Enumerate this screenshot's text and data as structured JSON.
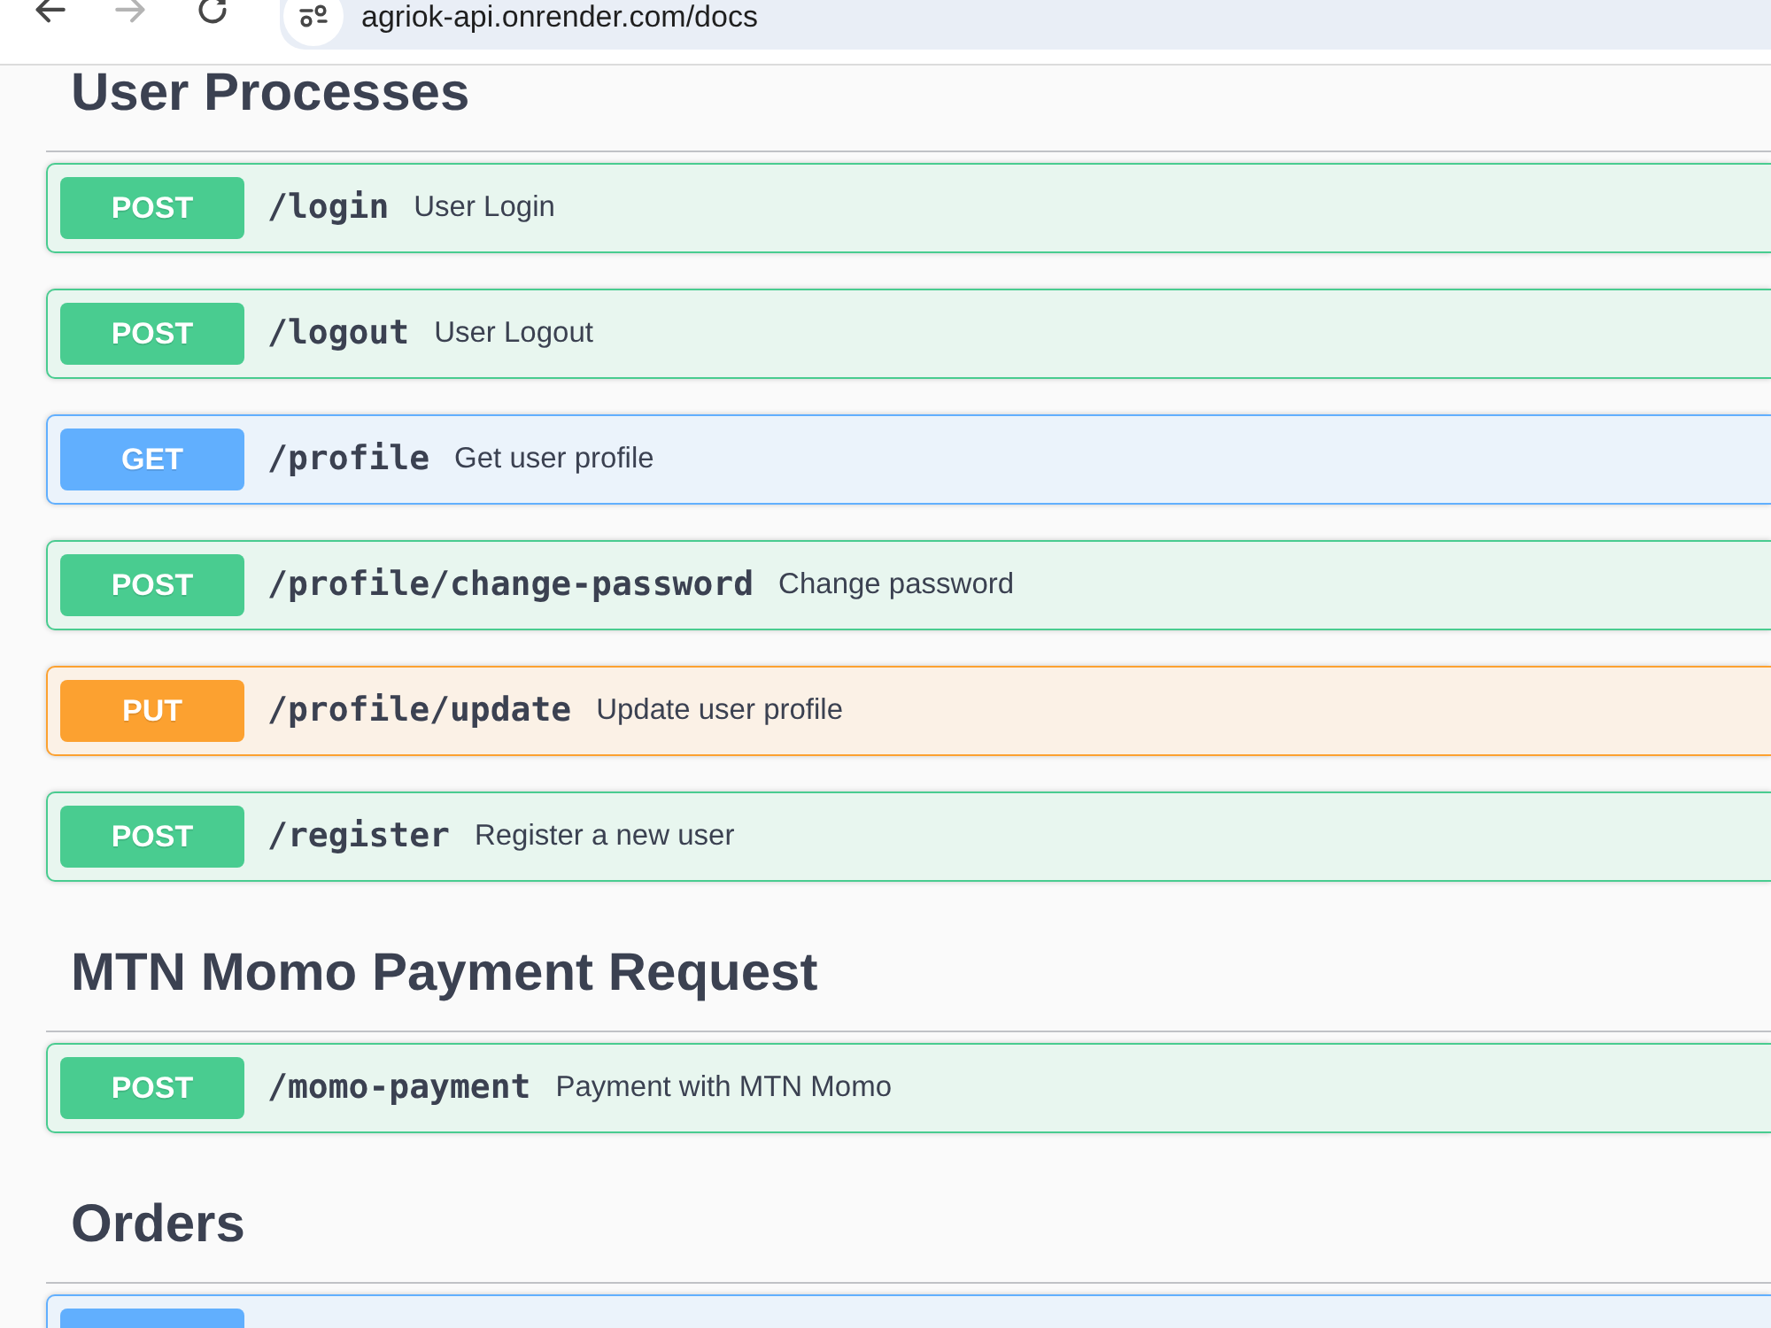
{
  "browser": {
    "nav_buttons": [
      {
        "kind": "back",
        "disabled": false
      },
      {
        "kind": "forward",
        "disabled": true
      },
      {
        "kind": "reload",
        "disabled": false
      }
    ],
    "url": "agriok-api.onrender.com/docs"
  },
  "sections": [
    {
      "title": "User Processes",
      "operations": [
        {
          "kind": "post",
          "method": "POST",
          "path": "/login",
          "summary": "User Login"
        },
        {
          "kind": "post",
          "method": "POST",
          "path": "/logout",
          "summary": "User Logout"
        },
        {
          "kind": "get",
          "method": "GET",
          "path": "/profile",
          "summary": "Get user profile"
        },
        {
          "kind": "post",
          "method": "POST",
          "path": "/profile/change-password",
          "summary": "Change password"
        },
        {
          "kind": "put",
          "method": "PUT",
          "path": "/profile/update",
          "summary": "Update user profile"
        },
        {
          "kind": "post",
          "method": "POST",
          "path": "/register",
          "summary": "Register a new user"
        }
      ]
    },
    {
      "title": "MTN Momo Payment Request",
      "operations": [
        {
          "kind": "post",
          "method": "POST",
          "path": "/momo-payment",
          "summary": "Payment with MTN Momo"
        }
      ]
    },
    {
      "title": "Orders",
      "operations": [
        {
          "kind": "get"
        }
      ]
    }
  ]
}
